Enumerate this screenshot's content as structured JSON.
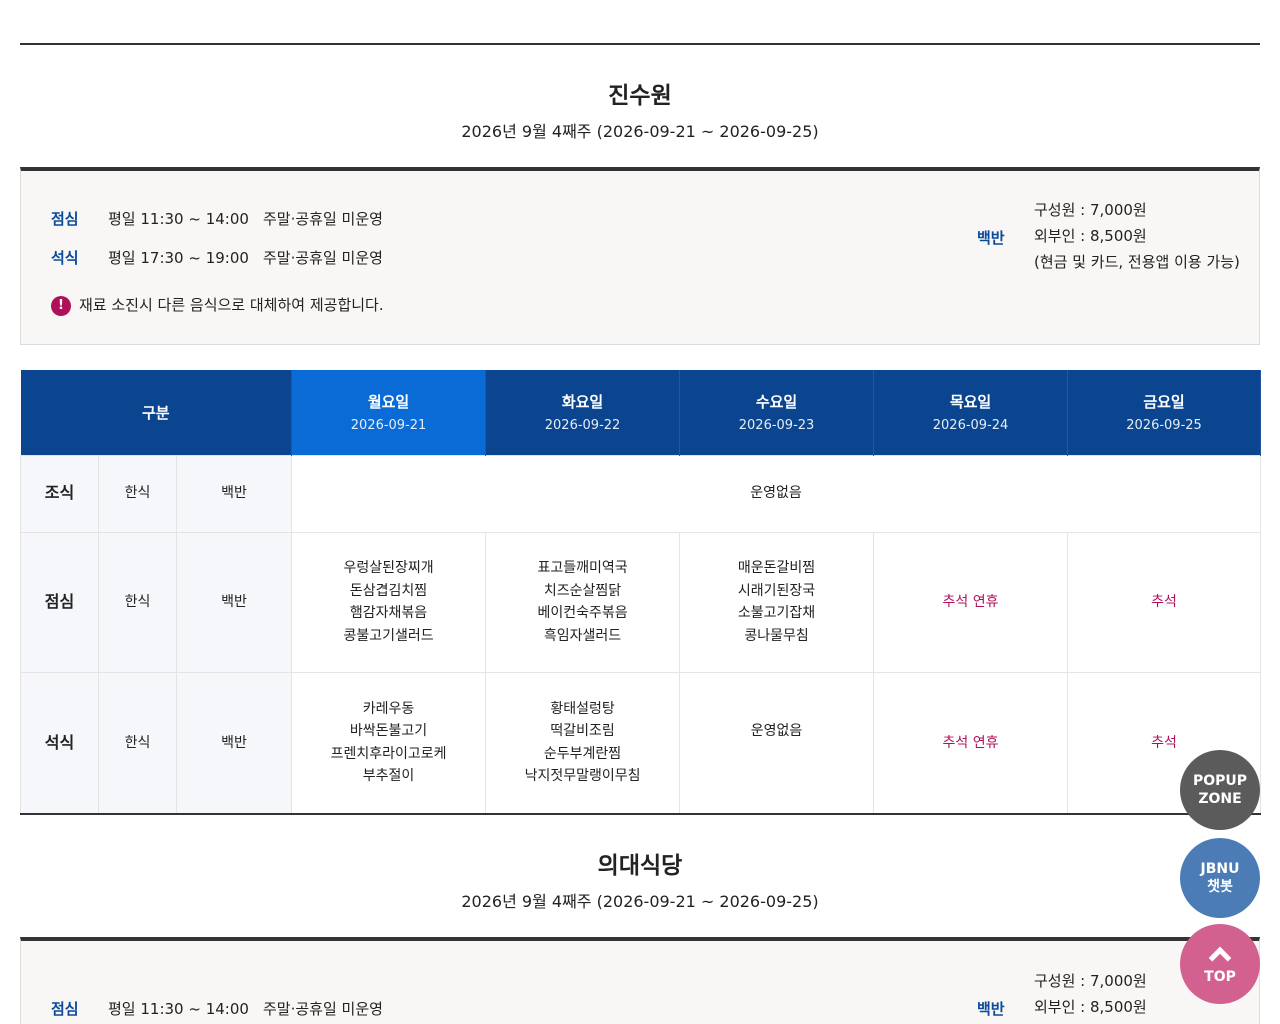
{
  "sections": [
    {
      "name": "진수원",
      "week": "2026년 9월 4째주 (2026-09-21 ~ 2026-09-25)",
      "hours": [
        {
          "meal": "점심",
          "weekday": "평일 11:30 ~ 14:00",
          "weekend": "주말·공휴일 미운영"
        },
        {
          "meal": "석식",
          "weekday": "평일 17:30 ~ 19:00",
          "weekend": "주말·공휴일 미운영"
        }
      ],
      "notice": "재료 소진시 다른 음식으로 대체하여 제공합니다.",
      "price_label": "백반",
      "prices": [
        "구성원 : 7,000원",
        "외부인 : 8,500원",
        "(현금 및 카드, 전용앱 이용 가능)"
      ]
    },
    {
      "name": "의대식당",
      "week": "2026년 9월 4째주 (2026-09-21 ~ 2026-09-25)",
      "hours": [
        {
          "meal": "점심",
          "weekday": "평일 11:30 ~ 14:00",
          "weekend": "주말·공휴일 미운영"
        }
      ],
      "price_label": "백반",
      "prices": [
        "구성원 : 7,000원",
        "외부인 : 8,500원"
      ]
    }
  ],
  "table": {
    "header_label": "구분",
    "days": [
      {
        "day": "월요일",
        "date": "2026-09-21",
        "active": true
      },
      {
        "day": "화요일",
        "date": "2026-09-22",
        "active": false
      },
      {
        "day": "수요일",
        "date": "2026-09-23",
        "active": false
      },
      {
        "day": "목요일",
        "date": "2026-09-24",
        "active": false
      },
      {
        "day": "금요일",
        "date": "2026-09-25",
        "active": false
      }
    ],
    "rows": [
      {
        "meal": "조식",
        "type": "한식",
        "kind": "백반",
        "closed_all": "운영없음"
      },
      {
        "meal": "점심",
        "type": "한식",
        "kind": "백반",
        "cells": [
          "우렁살된장찌개\n돈삼겹김치찜\n햄감자채볶음\n콩불고기샐러드",
          "표고들깨미역국\n치즈순살찜닭\n베이컨숙주볶음\n흑임자샐러드",
          "매운돈갈비찜\n시래기된장국\n소불고기잡채\n콩나물무침",
          "추석 연휴",
          "추석"
        ]
      },
      {
        "meal": "석식",
        "type": "한식",
        "kind": "백반",
        "cells": [
          "카레우동\n바싹돈불고기\n프렌치후라이고로케\n부추절이",
          "황태설렁탕\n떡갈비조림\n순두부계란찜\n낙지젓무말랭이무침",
          "운영없음",
          "추석 연휴",
          "추석"
        ]
      }
    ]
  },
  "floating": {
    "popup": [
      "POPUP",
      "ZONE"
    ],
    "chatbot": [
      "JBNU",
      "챗봇"
    ],
    "top": "TOP"
  },
  "colors": {
    "navy_header": "#0b4590",
    "active_header": "#0a6ad6",
    "holiday_text": "#b0105a",
    "meal_label": "#0b4a9b"
  }
}
